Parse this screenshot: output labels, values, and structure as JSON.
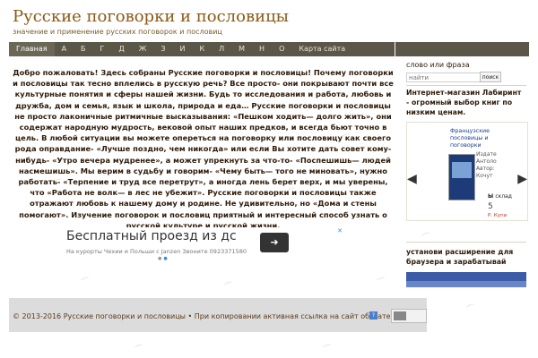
{
  "site": {
    "title": "Русские поговорки и пословицы",
    "tagline": "значение и применение русских поговорок и пословиц"
  },
  "nav": {
    "items": [
      {
        "label": "Главная",
        "active": true
      },
      {
        "label": "А"
      },
      {
        "label": "Б"
      },
      {
        "label": "Г"
      },
      {
        "label": "Д"
      },
      {
        "label": "Ж"
      },
      {
        "label": "З"
      },
      {
        "label": "И"
      },
      {
        "label": "К"
      },
      {
        "label": "Л"
      },
      {
        "label": "М"
      },
      {
        "label": "Н"
      },
      {
        "label": "О"
      },
      {
        "label": "Карта сайта"
      }
    ]
  },
  "main": {
    "text": "Добро пожаловать! Здесь собраны Русские поговорки и пословицы! Почему поговорки и пословицы так тесно вплелись в русскую речь? Все просто- они покрывают почти все культурные понятия и сферы нашей жизни. Будь то исследования и работа, любовь и дружба, дом и семья, язык и школа, природа и еда… Русские поговорки и пословицы не просто лаконичные ритмичные высказывания: «Пешком ходить— долго жить», они содержат народную мудрость, вековой опыт наших предков, и всегда бьют точно в цель. В любой ситуации вы можете опереться на поговорку или пословицу как своего рода оправдание- «Лучше поздно, чем никогда» или если Вы хотите дать совет кому-нибудь- «Утро вечера мудренее», а может упрекнуть за что-то- «Поспешишь— людей насмешишь». Мы верим в судьбу и говорим- «Чему быть— того не миновать», нужно работать- «Терпение и труд все перетрут», а иногда лень берет верх, и мы уверены, что «Работа не волк— в лес не убежит». Русские поговорки и пословицы также отражают любовь к нашему дому и родине. Не удивительно, но «Дома и стены помогают». Изучение поговорок и пословиц приятный и интересный способ узнать о русской культуре и русской жизни."
  },
  "ad": {
    "headline": "Бесплатный проезд из дс",
    "subline": "На курорты Чехии и Польши с Janzen Звоните 0923371580",
    "arrow": "➜",
    "close": "✕"
  },
  "sidebar": {
    "search_label": "слово или фраза",
    "search_placeholder": "найти",
    "search_button": "поиск",
    "promo_text": "Интернет-магазин Лабиринт - огромный выбор книг по низким ценам.",
    "book": {
      "title": "Французские пословицы и поговорки",
      "meta": [
        "Издате",
        "Антоло",
        "Автор:",
        "Кочут"
      ],
      "badge": "Ы",
      "sale": "склад",
      "price": "5",
      "shop": "Р. Купи"
    },
    "extension_text": "установи расширение для браузера и зарабатывай"
  },
  "footer": {
    "text": "© 2013-2016 Русские поговорки и пословицы • При копировании активная ссылка на сайт обязательна",
    "help_icon": "?"
  },
  "colors": {
    "title": "#8a5a16",
    "nav_bg": "#5a5648",
    "footer_bg": "#dcdcdc",
    "banner": "#3b5ba6"
  }
}
